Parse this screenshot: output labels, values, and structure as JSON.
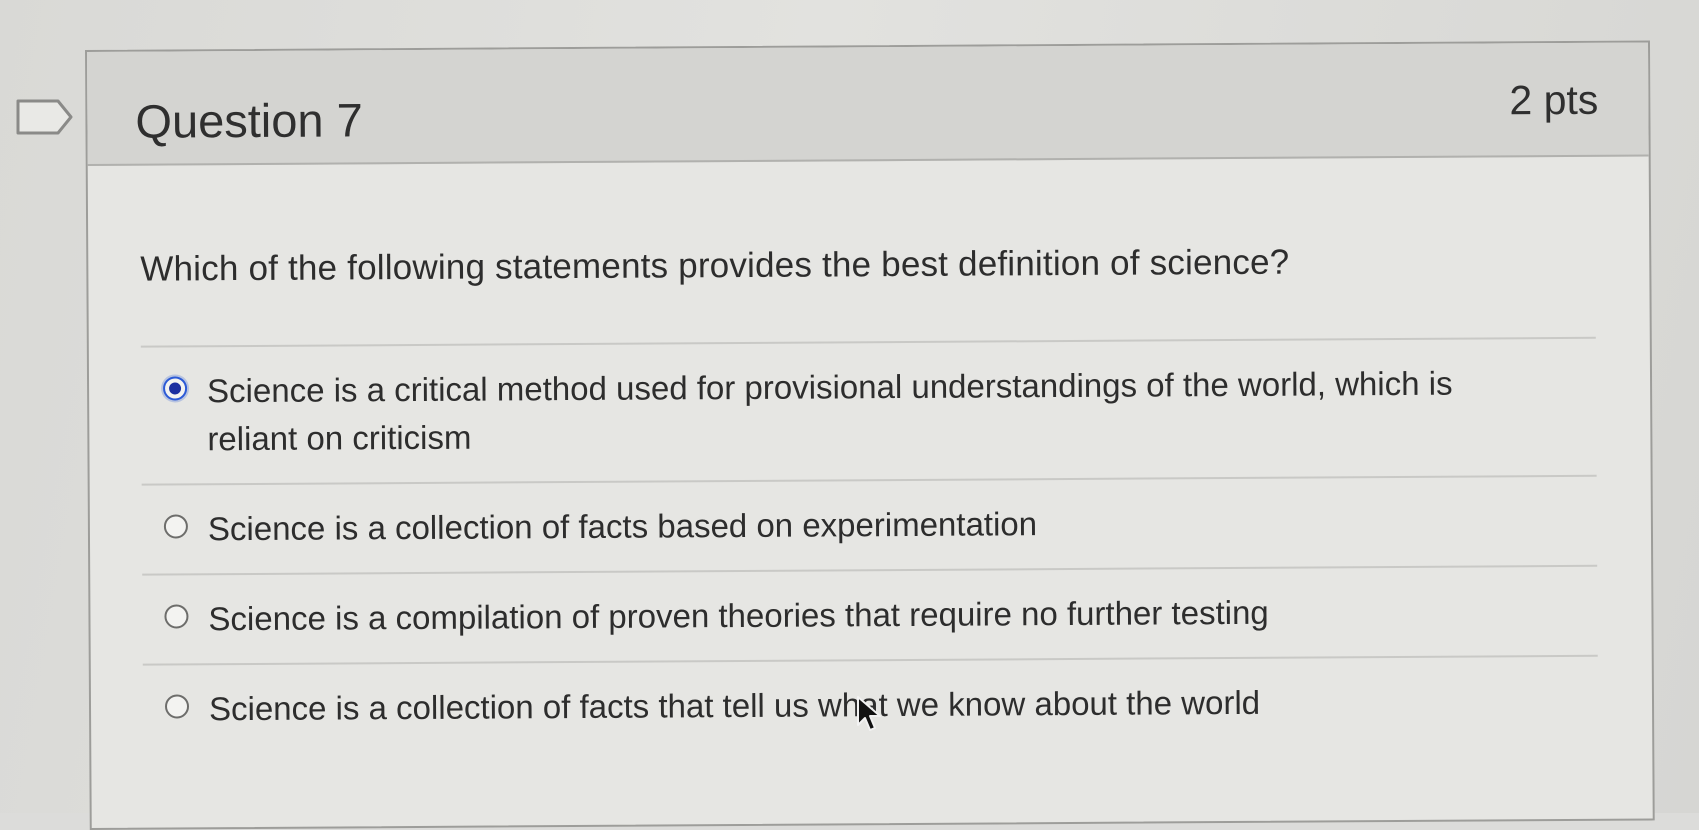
{
  "question": {
    "title": "Question 7",
    "points": "2 pts",
    "text": "Which of the following statements provides the best definition of science?"
  },
  "answers": [
    {
      "label": "Science is a critical method used for provisional understandings of the world, which is reliant on criticism",
      "selected": true
    },
    {
      "label": "Science is a collection of facts based on experimentation",
      "selected": false
    },
    {
      "label": "Science is a compilation of proven theories that require no further testing",
      "selected": false
    },
    {
      "label": "Science is a collection of facts that tell us what we know about the world",
      "selected": false
    }
  ],
  "icons": {
    "flag": "bookmark-flag-icon",
    "radio_selected": "radio-selected-icon",
    "radio_unselected": "radio-unselected-icon",
    "cursor": "mouse-pointer-icon"
  },
  "colors": {
    "radio_selected": "#1b2fa0",
    "header_bg": "#d4d4d1",
    "text": "#2d2d2d"
  }
}
